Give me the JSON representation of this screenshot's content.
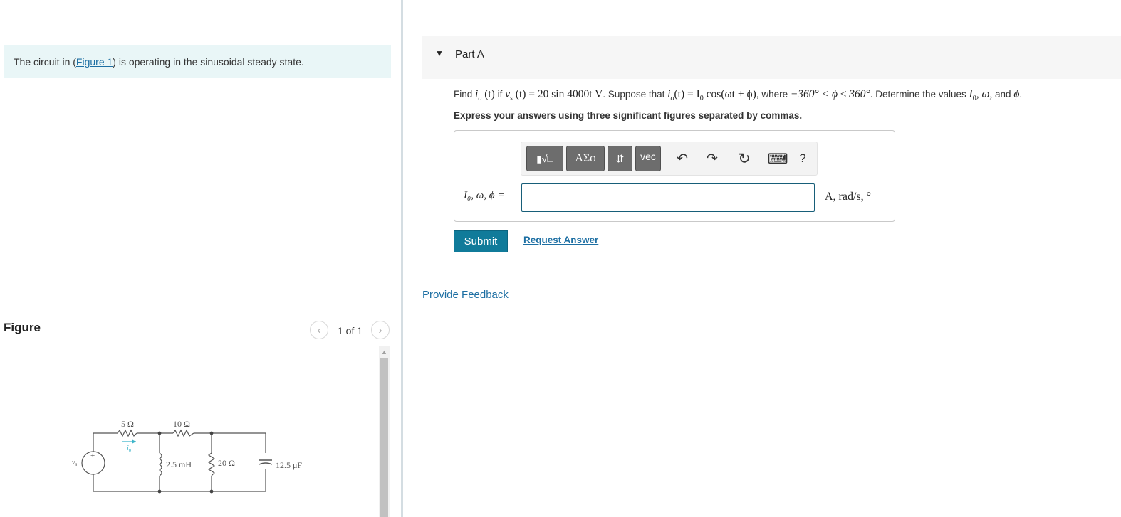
{
  "problem": {
    "intro_before": "The circuit in (",
    "intro_link": "Figure 1",
    "intro_after": ") is operating in the sinusoidal steady state."
  },
  "figure": {
    "heading": "Figure",
    "counter": "1 of 1",
    "prev_icon": "chevron-left-icon",
    "next_icon": "chevron-right-icon",
    "circuit_labels": {
      "r1": "5 Ω",
      "r2": "10 Ω",
      "inductor": "2.5 mH",
      "r3": "20 Ω",
      "capacitor": "12.5 μF",
      "source": "v",
      "source_sub": "s",
      "current": "i",
      "current_sub": "o"
    }
  },
  "part": {
    "title": "Part A",
    "question": {
      "t1": "Find ",
      "m1": "i",
      "m1sub": "o",
      "m1b": " (t)",
      "t2": " if ",
      "m2": "v",
      "m2sub": "s",
      "m2b": " (t) = 20 sin 4000t V",
      "t3": ". Suppose that ",
      "m3": "i",
      "m3sub": "o",
      "m3b": "(t) = I",
      "m3sub2": "0",
      "m3c": " cos(ωt + ϕ)",
      "t4": ", where ",
      "m4": "−360° < ϕ ≤ 360°",
      "t5": ". Determine the values ",
      "m5": "I",
      "m5sub": "0",
      "m5b": ", ω,",
      "t6": " and ",
      "m6": "ϕ",
      "t7": "."
    },
    "instruction": "Express your answers using three significant figures separated by commas.",
    "toolbar": {
      "templates_label": "▮√□",
      "greek_label": "ΑΣϕ",
      "arrows_label": "⇵",
      "vec_label": "vec",
      "undo_icon": "↶",
      "redo_icon": "↷",
      "reset_icon": "↻",
      "keyboard_icon": "⌨",
      "help_label": "?"
    },
    "answer_label": "I₀, ω, ϕ =",
    "answer_value": "",
    "units": "A, rad/s, °",
    "submit_label": "Submit",
    "request_label": "Request Answer"
  },
  "feedback_label": "Provide Feedback"
}
